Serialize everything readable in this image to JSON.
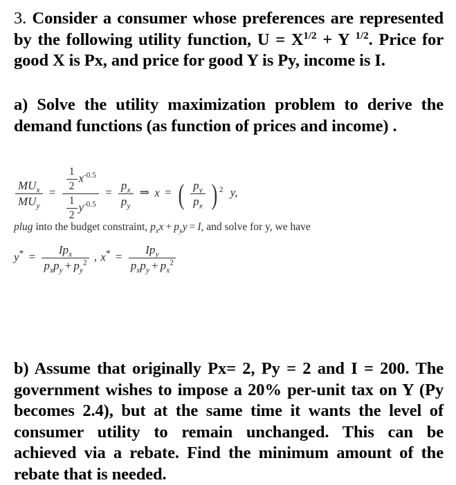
{
  "document": {
    "background_color": "#ffffff",
    "text_color": "#000000",
    "math_ink_color": "#2b2b2b"
  },
  "stem": {
    "number": "3.",
    "text_part_1": "Consider a consumer whose preferences are represented by the following utility function,  U = X",
    "exponent_1": "1/2",
    "text_part_2": "+ Y ",
    "exponent_2": "1/2",
    "text_part_3": ". Price for good X is Px, and price for good Y is Py, income is I."
  },
  "part_a": {
    "label": "a)",
    "text": "Solve the utility maximization problem to derive the demand functions (as function of prices and income) ."
  },
  "math_mrs": {
    "mu_numerator": "MU",
    "mu_numerator_sub": "x",
    "mu_denominator": "MU",
    "mu_denominator_sub": "y",
    "equals_1": "=",
    "half_num": "1",
    "half_den": "2",
    "var_x": "x",
    "exp_x": "-0.5",
    "var_y": "y",
    "exp_y": "-0.5",
    "equals_2": "=",
    "price_num": "p",
    "price_num_sub": "x",
    "price_den": "p",
    "price_den_sub": "y",
    "implies": "⇒",
    "result_var": "x",
    "equals_3": "=",
    "ratio_num": "p",
    "ratio_num_sub": "y",
    "ratio_den": "p",
    "ratio_den_sub": "x",
    "ratio_power": "2",
    "trailing": "y,"
  },
  "math_plug": {
    "italic_word": "plug",
    "text_1": " into the budget constraint, ",
    "p_x": "p",
    "p_x_sub": "x",
    "var_x": "x",
    "plus": "+",
    "p_y": "p",
    "p_y_sub": "y",
    "var_y": "y",
    "equals": "=",
    "income": "I",
    "text_2": ", and solve for y, we have"
  },
  "math_solution": {
    "y_star": "y",
    "star": "*",
    "equals_1": "=",
    "y_num_I": "I",
    "y_num_p": "p",
    "y_num_p_sub": "x",
    "y_den_p1": "p",
    "y_den_p1_sub": "x",
    "y_den_p2": "p",
    "y_den_p2_sub": "y",
    "y_den_plus": "+",
    "y_den_p3": "p",
    "y_den_p3_sub": "y",
    "y_den_p3_pow": "2",
    "comma": ",",
    "x_star": "x",
    "equals_2": "=",
    "x_num_I": "I",
    "x_num_p": "p",
    "x_num_p_sub": "y",
    "x_den_p1": "p",
    "x_den_p1_sub": "x",
    "x_den_p2": "p",
    "x_den_p2_sub": "y",
    "x_den_plus": "+",
    "x_den_p3": "p",
    "x_den_p3_sub": "x",
    "x_den_p3_pow": "2"
  },
  "part_b": {
    "label": "b)",
    "text": "Assume that originally Px= 2, Py = 2 and I = 200. The government wishes to impose a 20% per-unit tax on Y (Py becomes 2.4), but at the same time it wants the level of consumer utility to remain unchanged. This can be achieved via a rebate. Find the minimum amount of the rebate that is needed."
  }
}
